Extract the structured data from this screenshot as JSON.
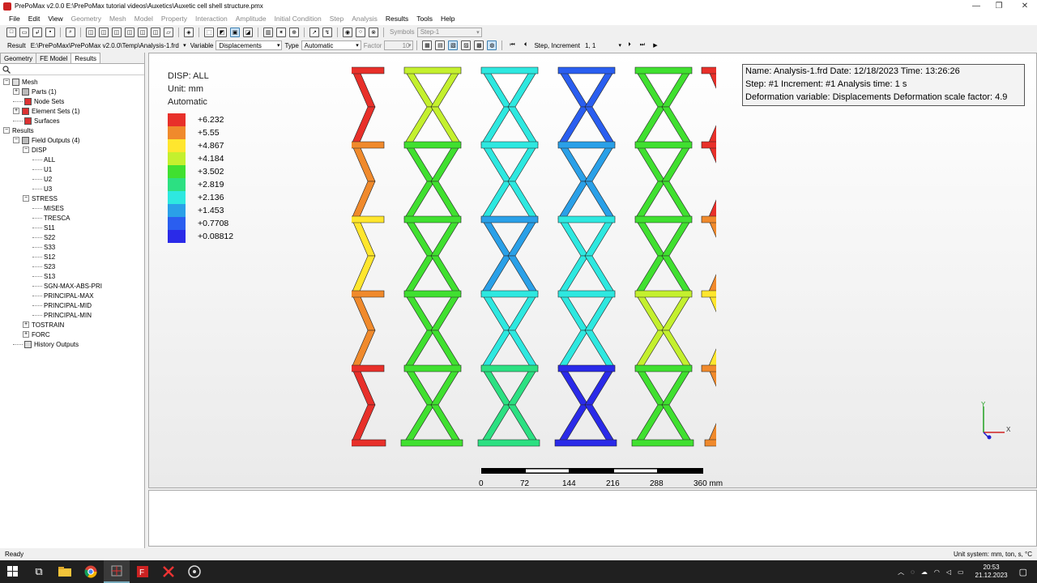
{
  "window": {
    "title": "PrePoMax v2.0.0  E:\\PrePoMax tutorial videos\\Auxetics\\Auxetic cell shell structure.pmx",
    "minimize": "—",
    "restore": "❐",
    "close": "✕"
  },
  "menu": [
    "File",
    "Edit",
    "View",
    "Geometry",
    "Mesh",
    "Model",
    "Property",
    "Interaction",
    "Amplitude",
    "Initial Condition",
    "Step",
    "Analysis",
    "Results",
    "Tools",
    "Help"
  ],
  "toolbar1": {
    "symbols_label": "Symbols",
    "symbols_value": "Step-1"
  },
  "toolbar2": {
    "result_label": "Result",
    "result_value": "E:\\PrePoMax\\PrePoMax v2.0.0\\Temp\\Analysis-1.frd",
    "variable_label": "Variable",
    "variable_value": "Displacements",
    "type_label": "Type",
    "type_value": "Automatic",
    "factor_label": "Factor",
    "factor_value": "10",
    "step_label": "Step, Increment",
    "step_value": "1, 1"
  },
  "left_panel": {
    "tabs": [
      "Geometry",
      "FE Model",
      "Results"
    ],
    "tree": [
      {
        "label": "Mesh",
        "depth": 0,
        "expander": "−",
        "icon": "mesh"
      },
      {
        "label": "Parts (1)",
        "depth": 1,
        "expander": "+",
        "icon": "grid"
      },
      {
        "label": "Node Sets",
        "depth": 1,
        "expander": "",
        "icon": "red"
      },
      {
        "label": "Element Sets (1)",
        "depth": 1,
        "expander": "+",
        "icon": "red"
      },
      {
        "label": "Surfaces",
        "depth": 1,
        "expander": "",
        "icon": "red"
      },
      {
        "label": "Results",
        "depth": 0,
        "expander": "−",
        "icon": ""
      },
      {
        "label": "Field Outputs (4)",
        "depth": 1,
        "expander": "−",
        "icon": "grid"
      },
      {
        "label": "DISP",
        "depth": 2,
        "expander": "−",
        "icon": ""
      },
      {
        "label": "ALL",
        "depth": 3,
        "expander": "",
        "icon": ""
      },
      {
        "label": "U1",
        "depth": 3,
        "expander": "",
        "icon": ""
      },
      {
        "label": "U2",
        "depth": 3,
        "expander": "",
        "icon": ""
      },
      {
        "label": "U3",
        "depth": 3,
        "expander": "",
        "icon": ""
      },
      {
        "label": "STRESS",
        "depth": 2,
        "expander": "−",
        "icon": ""
      },
      {
        "label": "MISES",
        "depth": 3,
        "expander": "",
        "icon": ""
      },
      {
        "label": "TRESCA",
        "depth": 3,
        "expander": "",
        "icon": ""
      },
      {
        "label": "S11",
        "depth": 3,
        "expander": "",
        "icon": ""
      },
      {
        "label": "S22",
        "depth": 3,
        "expander": "",
        "icon": ""
      },
      {
        "label": "S33",
        "depth": 3,
        "expander": "",
        "icon": ""
      },
      {
        "label": "S12",
        "depth": 3,
        "expander": "",
        "icon": ""
      },
      {
        "label": "S23",
        "depth": 3,
        "expander": "",
        "icon": ""
      },
      {
        "label": "S13",
        "depth": 3,
        "expander": "",
        "icon": ""
      },
      {
        "label": "SGN-MAX-ABS-PRI",
        "depth": 3,
        "expander": "",
        "icon": ""
      },
      {
        "label": "PRINCIPAL-MAX",
        "depth": 3,
        "expander": "",
        "icon": ""
      },
      {
        "label": "PRINCIPAL-MID",
        "depth": 3,
        "expander": "",
        "icon": ""
      },
      {
        "label": "PRINCIPAL-MIN",
        "depth": 3,
        "expander": "",
        "icon": ""
      },
      {
        "label": "TOSTRAIN",
        "depth": 2,
        "expander": "+",
        "icon": ""
      },
      {
        "label": "FORC",
        "depth": 2,
        "expander": "+",
        "icon": ""
      },
      {
        "label": "History Outputs",
        "depth": 1,
        "expander": "",
        "icon": "history"
      }
    ]
  },
  "legend": {
    "title": "DISP: ALL",
    "unit": "Unit: mm",
    "mode": "Automatic",
    "values": [
      "+6.232",
      "+5.55",
      "+4.867",
      "+4.184",
      "+3.502",
      "+2.819",
      "+2.136",
      "+1.453",
      "+0.7708",
      "+0.08812"
    ],
    "colors": [
      "#e8302a",
      "#f08a2c",
      "#ffe62e",
      "#c4f02e",
      "#40e030",
      "#2ce082",
      "#2ee8e0",
      "#2aa0e8",
      "#2a5ef0",
      "#2a2ae8"
    ]
  },
  "info": {
    "line1": "Name: Analysis-1.frd   Date: 12/18/2023   Time: 13:26:26",
    "line2": "Step: #1   Increment: #1   Analysis time: 1 s",
    "line3": "Deformation variable: Displacements   Deformation scale factor: 4.9"
  },
  "scale": {
    "ticks": [
      "0",
      "72",
      "144",
      "216",
      "288",
      "360 mm"
    ]
  },
  "axes": {
    "y": "Y",
    "x": "X",
    "z": "Z"
  },
  "status": {
    "left": "Ready",
    "right": "Unit system: mm, ton, s, °C"
  },
  "taskbar": {
    "time": "20:53",
    "date": "21.12.2023"
  }
}
